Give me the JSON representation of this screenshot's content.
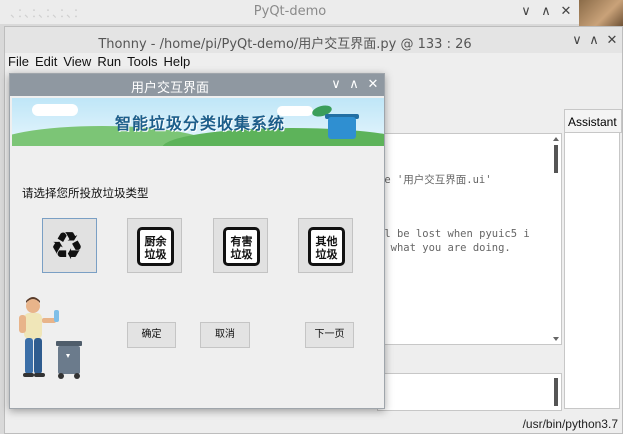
{
  "outer_window": {
    "title": "PyQt-demo"
  },
  "thonny": {
    "title": "Thonny  -  /home/pi/PyQt-demo/用户交互界面.py  @  133 : 26",
    "menu": [
      "File",
      "Edit",
      "View",
      "Run",
      "Tools",
      "Help"
    ],
    "code_lines": [
      "le '用户交互界面.ui'",
      "",
      "",
      "ll be lost when pyuic5 i",
      "w what you are doing."
    ],
    "assistant_tab": "Assistant",
    "status": "/usr/bin/python3.7"
  },
  "dialog": {
    "title": "用户交互界面",
    "banner_text": "智能垃圾分类收集系统",
    "prompt": "请选择您所投放垃圾类型",
    "categories": [
      {
        "name": "可回收物",
        "icon": "recycle-icon"
      },
      {
        "line1": "厨余",
        "line2": "垃圾",
        "icon": "kitchen-waste-icon"
      },
      {
        "line1": "有害",
        "line2": "垃圾",
        "icon": "hazardous-waste-icon"
      },
      {
        "line1": "其他",
        "line2": "垃圾",
        "icon": "other-waste-icon"
      }
    ],
    "buttons": {
      "confirm": "确定",
      "cancel": "取消",
      "next": "下一页"
    }
  },
  "window_controls": {
    "minimize": "∨",
    "maximize": "∧",
    "close": "✕"
  }
}
